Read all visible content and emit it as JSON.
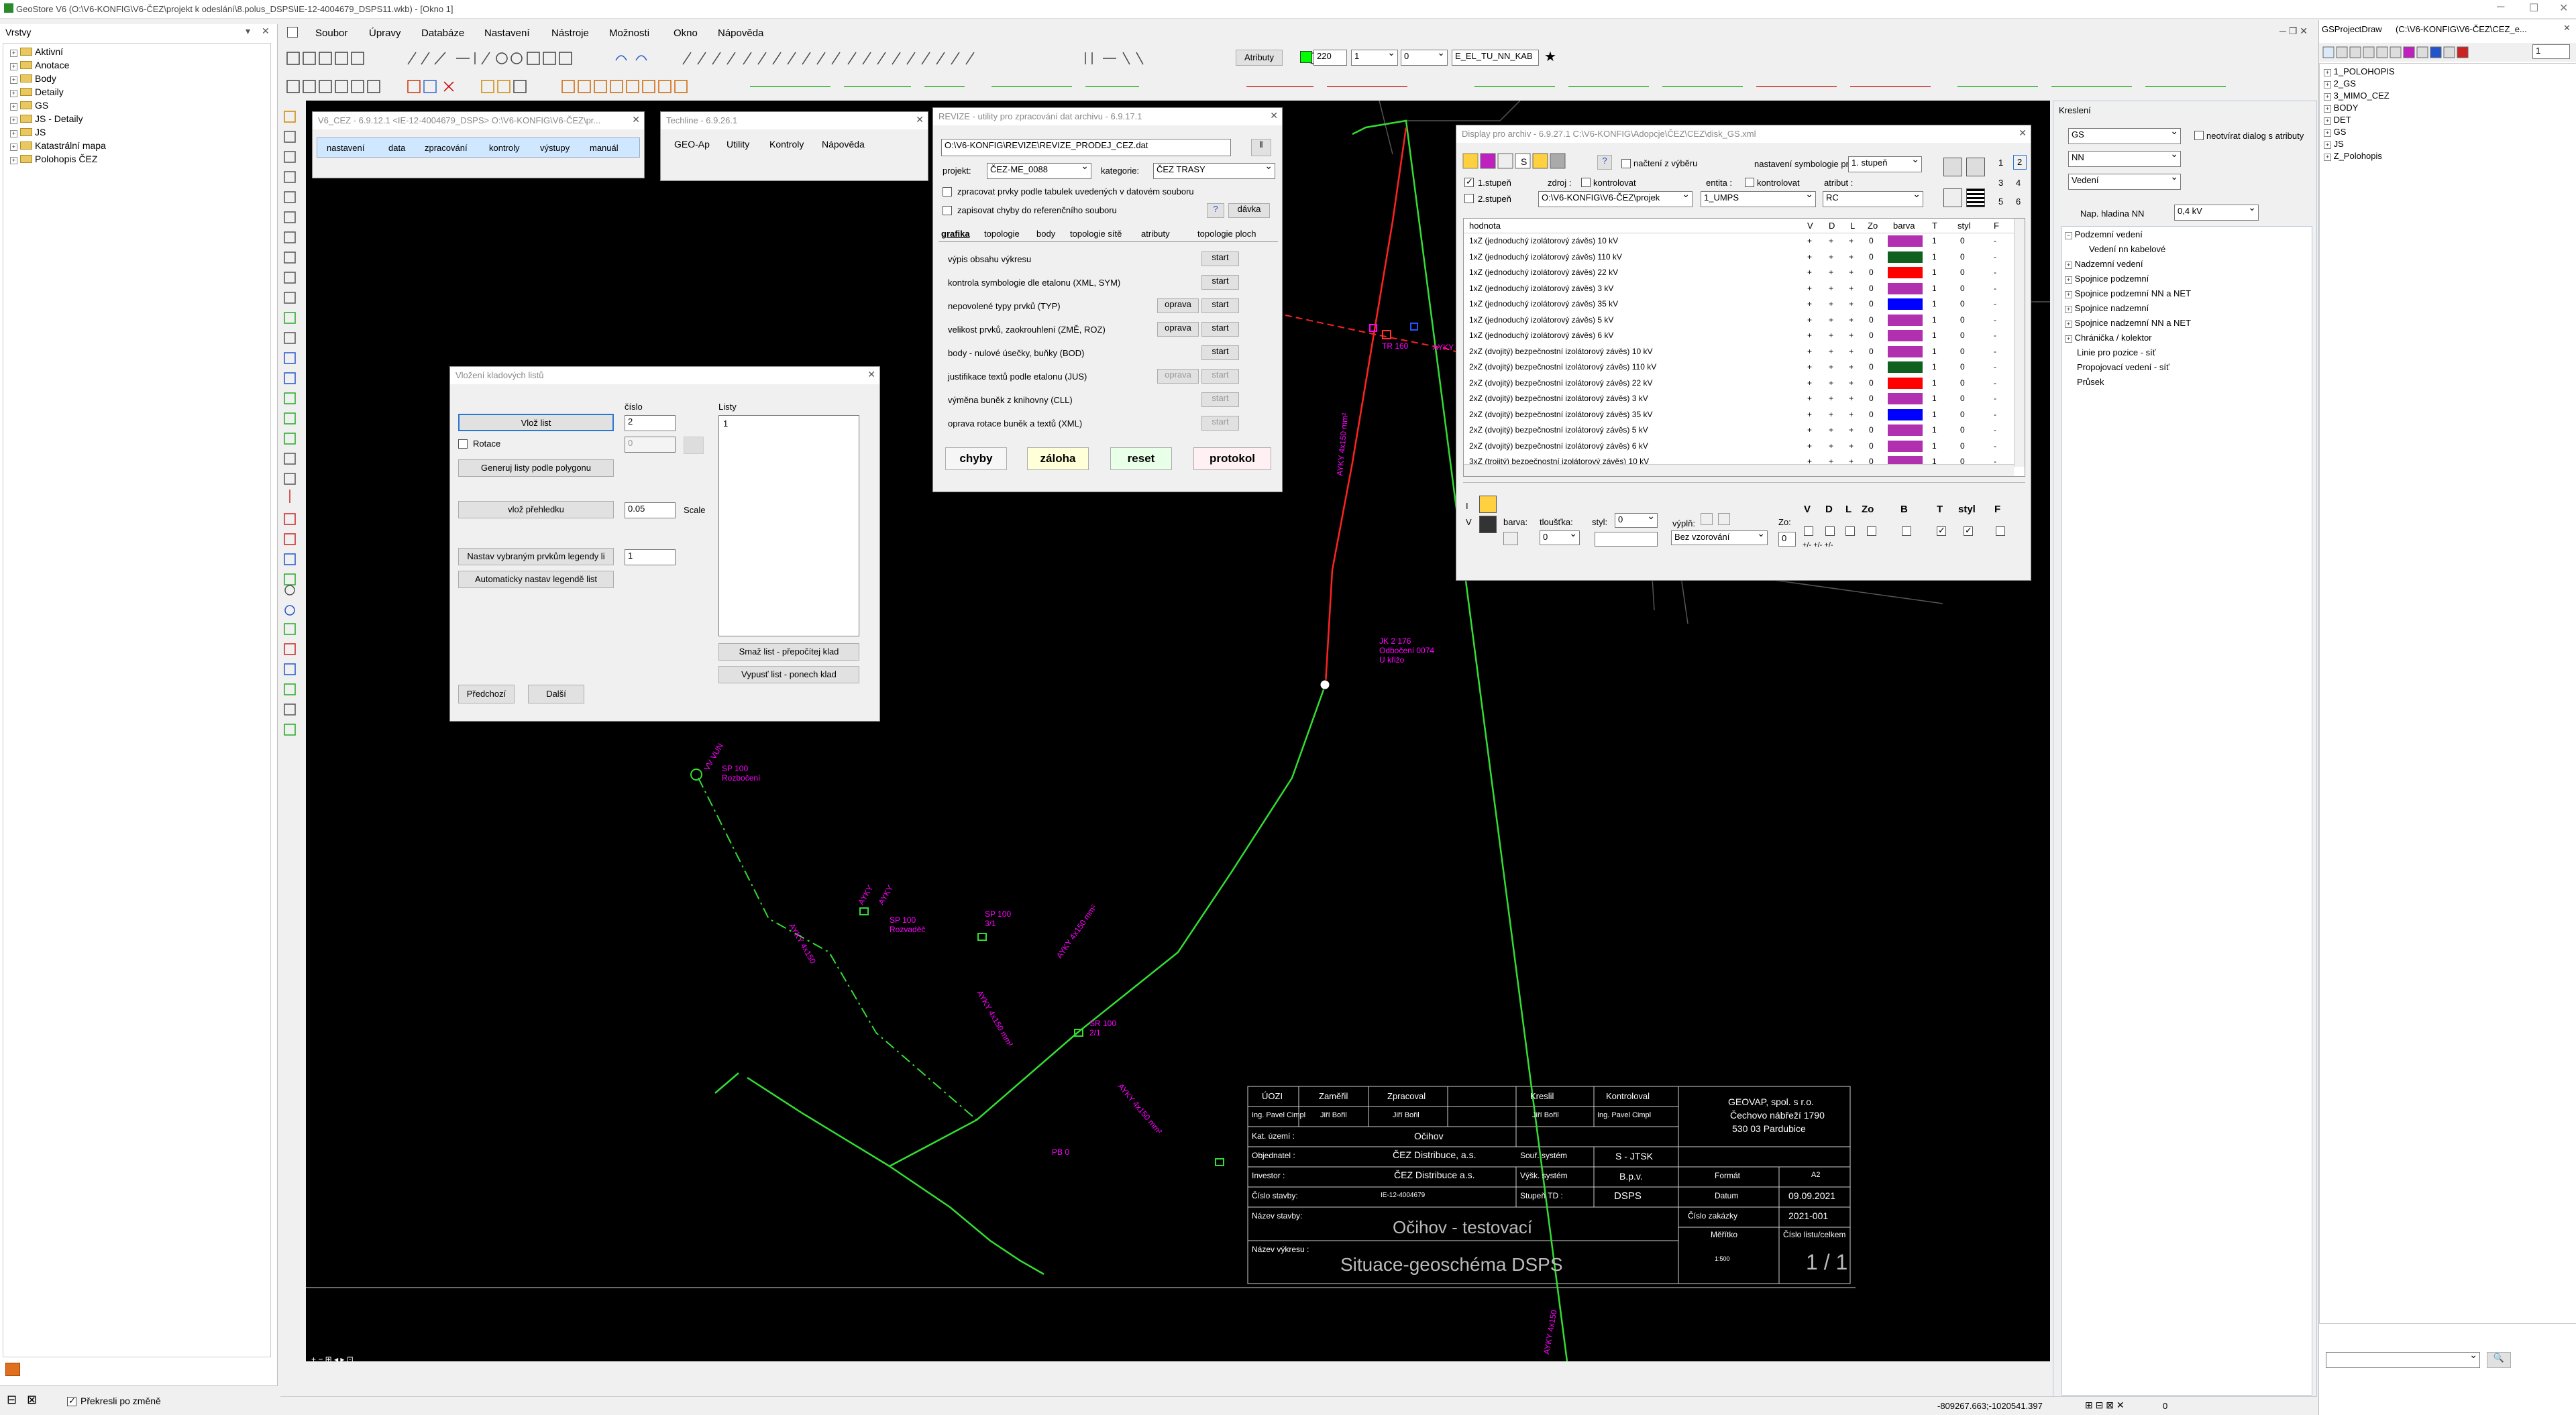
{
  "app": {
    "title": "GeoStore V6 (O:\\V6-KONFIG\\V6-ČEZ\\projekt k odeslání\\8.polus_DSPS\\IE-12-4004679_DSPS11.wkb) - [Okno 1]"
  },
  "menu": [
    "Soubor",
    "Úpravy",
    "Databáze",
    "Nastavení",
    "Nástroje",
    "Možnosti",
    "Okno",
    "Nápověda"
  ],
  "toolbar": {
    "atributy": "Atributy",
    "width_value": "220",
    "line1": "1",
    "line0": "0",
    "layer": "E_EL_TU_NN_KAB"
  },
  "left_panel": {
    "title": "Vrstvy",
    "items": [
      "Aktivní",
      "Anotace",
      "Body",
      "Detaily",
      "GS",
      "JS - Detaily",
      "JS",
      "Katastrální mapa",
      "Polohopis ČEZ"
    ],
    "bottom_check": "Překresli po změně"
  },
  "right_panel": {
    "title": "GSProjectDraw",
    "path": "(C:\\V6-KONFIG\\V6-ČEZ\\CEZ_e...",
    "spin": "1",
    "items": [
      "1_POLOHOPIS",
      "2_GS",
      "3_MIMO_CEZ",
      "BODY",
      "DET",
      "GS",
      "JS",
      "Z_Polohopis"
    ]
  },
  "kresleni": {
    "title": "Kreslení",
    "combo1": "GS",
    "combo2": "NN",
    "combo3": "Vedení",
    "check": "neotvírat dialog s atributy",
    "nap_label": "Nap. hladina NN",
    "nap_value": "0,4 kV",
    "tree": [
      "Podzemní vedení",
      "Vedení nn kabelové",
      "Nadzemní vedení",
      "Spojnice podzemní",
      "Spojnice podzemní NN a NET",
      "Spojnice nadzemní",
      "Spojnice nadzemní NN a NET",
      "Chránička / kolektor",
      "Linie pro pozice - síť",
      "Propojovací vedení - síť",
      "Průsek"
    ]
  },
  "win_v6cez": {
    "title": "V6_CEZ - 6.9.12.1 <IE-12-4004679_DSPS> O:\\V6-KONFIG\\V6-ČEZ\\pr...",
    "menu": [
      "nastavení",
      "data",
      "zpracování",
      "kontroly",
      "výstupy",
      "manuál"
    ]
  },
  "win_techline": {
    "title": "Techline - 6.9.26.1",
    "menu": [
      "GEO-Ap",
      "Utility",
      "Kontroly",
      "Nápověda"
    ]
  },
  "win_revize": {
    "title": "REVIZE - utility pro zpracování dat archivu - 6.9.17.1",
    "path": "O:\\V6-KONFIG\\REVIZE\\REVIZE_PRODEJ_CEZ.dat",
    "projekt_label": "projekt:",
    "projekt": "ČEZ-ME_0088",
    "kategorie_label": "kategorie:",
    "kategorie": "ČEZ TRASY",
    "chk1": "zpracovat prvky podle tabulek uvedených v datovém souboru",
    "chk2": "zapisovat chyby do referenčního souboru",
    "davka": "dávka",
    "help": "?",
    "tabs": [
      "grafika",
      "topologie",
      "body",
      "topologie sítě",
      "atributy",
      "topologie ploch"
    ],
    "rows": [
      {
        "label": "výpis obsahu výkresu",
        "oprava": "",
        "start": "start"
      },
      {
        "label": "kontrola symbologie dle etalonu (XML, SYM)",
        "oprava": "",
        "start": "start"
      },
      {
        "label": "nepovolené typy prvků (TYP)",
        "oprava": "oprava",
        "start": "start"
      },
      {
        "label": "velikost prvků, zaokrouhlení (ZMĚ, ROZ)",
        "oprava": "oprava",
        "start": "start"
      },
      {
        "label": "body - nulové úsečky, buňky (BOD)",
        "oprava": "",
        "start": "start"
      },
      {
        "label": "justifikace textů podle etalonu (JUS)",
        "oprava": "oprava",
        "start": "start"
      },
      {
        "label": "výměna buněk z knihovny (CLL)",
        "oprava": "",
        "start": "start"
      },
      {
        "label": "oprava rotace buněk a textů (XML)",
        "oprava": "",
        "start": "start"
      }
    ],
    "buttons": [
      "chyby",
      "záloha",
      "reset",
      "protokol"
    ]
  },
  "win_vlozeni": {
    "title": "Vložení kladových listů",
    "cislo_label": "číslo",
    "listy_label": "Listy",
    "vloz_list": "Vlož list",
    "cislo_value": "2",
    "rotace": "Rotace",
    "rot_value": "0",
    "generuj": "Generuj listy podle polygonu",
    "listy_value": "1",
    "vloz_prehledku": "vlož přehledku",
    "scale_value": "0.05",
    "scale_label": "Scale",
    "nastav": "Nastav vybraným prvkům legendy li",
    "nastav_value": "1",
    "auto": "Automaticky nastav legendě list",
    "smaz": "Smaž list - přepočítej klad",
    "vypust": "Vypusť list - ponech klad",
    "predchozi": "Předchozí",
    "dalsi": "Další"
  },
  "win_display": {
    "title": "Display pro archiv - 6.9.27.1 C:\\V6-KONFIG\\Adopcje\\ČEZ\\CEZ\\disk_GS.xml",
    "nacteni": "načtení z výběru",
    "nastaveni_label": "nastavení symbologie pro",
    "nastaveni_value": "1. stupeň",
    "stupen1": "1.stupeň",
    "stupen2": "2.stupeň",
    "zdroj": "zdroj :",
    "kontrolovat": "kontrolovat",
    "entita": "entita :",
    "kontrolovat2": "kontrolovat",
    "atribut": "atribut :",
    "path": "O:\\V6-KONFIG\\V6-ČEZ\\projek",
    "entita_value": "1_UMPS",
    "atribut_value": "RC",
    "headers": [
      "hodnota",
      "V",
      "D",
      "L",
      "Zo",
      "barva",
      "T",
      "styl",
      "F"
    ],
    "rows": [
      {
        "h": "1xZ (jednoduchý izolátorový závěs) 10 kV",
        "c": "#b030b0"
      },
      {
        "h": "1xZ (jednoduchý izolátorový závěs) 110 kV",
        "c": "#106020"
      },
      {
        "h": "1xZ (jednoduchý izolátorový závěs) 22 kV",
        "c": "#ff0000"
      },
      {
        "h": "1xZ (jednoduchý izolátorový závěs) 3 kV",
        "c": "#b030b0"
      },
      {
        "h": "1xZ (jednoduchý izolátorový závěs) 35 kV",
        "c": "#0000ff"
      },
      {
        "h": "1xZ (jednoduchý izolátorový závěs) 5 kV",
        "c": "#b030b0"
      },
      {
        "h": "1xZ (jednoduchý izolátorový závěs) 6 kV",
        "c": "#b030b0"
      },
      {
        "h": "2xZ (dvojitý) bezpečnostní izolátorový závěs) 10 kV",
        "c": "#b030b0"
      },
      {
        "h": "2xZ (dvojitý) bezpečnostní izolátorový závěs) 110 kV",
        "c": "#106020"
      },
      {
        "h": "2xZ (dvojitý) bezpečnostní izolátorový závěs) 22 kV",
        "c": "#ff0000"
      },
      {
        "h": "2xZ (dvojitý) bezpečnostní izolátorový závěs) 3 kV",
        "c": "#b030b0"
      },
      {
        "h": "2xZ (dvojitý) bezpečnostní izolátorový závěs) 35 kV",
        "c": "#0000ff"
      },
      {
        "h": "2xZ (dvojitý) bezpečnostní izolátorový závěs) 5 kV",
        "c": "#b030b0"
      },
      {
        "h": "2xZ (dvojitý) bezpečnostní izolátorový závěs) 6 kV",
        "c": "#b030b0"
      },
      {
        "h": "3xZ (trojitý) bezpečnostní izolátorový závěs) 10 kV",
        "c": "#b030b0"
      }
    ],
    "row_vals": [
      "+",
      "+",
      "+",
      "0",
      "1",
      "0",
      "-"
    ],
    "barva": "barva:",
    "tloustka": "tloušťka:",
    "styl": "styl:",
    "styl_value": "0",
    "tl_value": "0",
    "vypln": "výplň:",
    "vypln_value": "Bez vzorování",
    "zo": "Zo:",
    "zo_value": "0",
    "flags": [
      "V",
      "D",
      "L",
      "Zo",
      "B",
      "T",
      "styl",
      "F"
    ],
    "nums": [
      "1",
      "2",
      "3",
      "4",
      "5",
      "6"
    ]
  },
  "titleblock": {
    "r1": [
      "ÚOZI",
      "Zaměřil",
      "Zpracoval",
      "Kreslil",
      "Kontroloval"
    ],
    "r2": [
      "Ing. Pavel Cimpl",
      "Jiří Bořil",
      "Jiří Bořil",
      "Jiří Bořil",
      "Ing. Pavel Cimpl"
    ],
    "company": "GEOVAP, spol. s r.o.",
    "street": "Čechovo nábřeží 1790",
    "city": "530 03 Pardubice",
    "kat_label": "Kat. území :",
    "kat": "Očihov",
    "obj_label": "Objednatel :",
    "obj": "ČEZ Distribuce, a.s.",
    "souc_label": "Souř. systém",
    "souc": "S - JTSK",
    "formatl": "Formát",
    "format": "A2",
    "inv_label": "Investor :",
    "inv": "ČEZ Distribuce a.s.",
    "vysk_label": "Výšk. systém",
    "vysk": "B.p.v.",
    "datum_label": "Datum",
    "datum": "09.09.2021",
    "cislo_label": "Číslo stavby:",
    "cislo": "IE-12-4004679",
    "stupen_label": "Stupeň TD :",
    "stupen": "DSPS",
    "zakazka_label": "Číslo zakázky",
    "zakazka": "2021-001",
    "nazev_label": "Název stavby:",
    "nazev": "Očihov - testovací",
    "meritko_label": "Měřítko",
    "meritko": "1:500",
    "list_label": "Číslo listu/celkem",
    "vykres_label": "Název výkresu :",
    "vykres": "Situace-geoschéma DSPS",
    "list": "1 / 1"
  },
  "map_labels": {
    "sp100": "SP 100",
    "sr100": "SR 100",
    "kabel": "AYKY 4x150 mm²",
    "vv": "VV VUN",
    "pbo": "PB 0"
  },
  "status": {
    "coords": "-809267.663;-1020541.397",
    "spin": "0"
  }
}
